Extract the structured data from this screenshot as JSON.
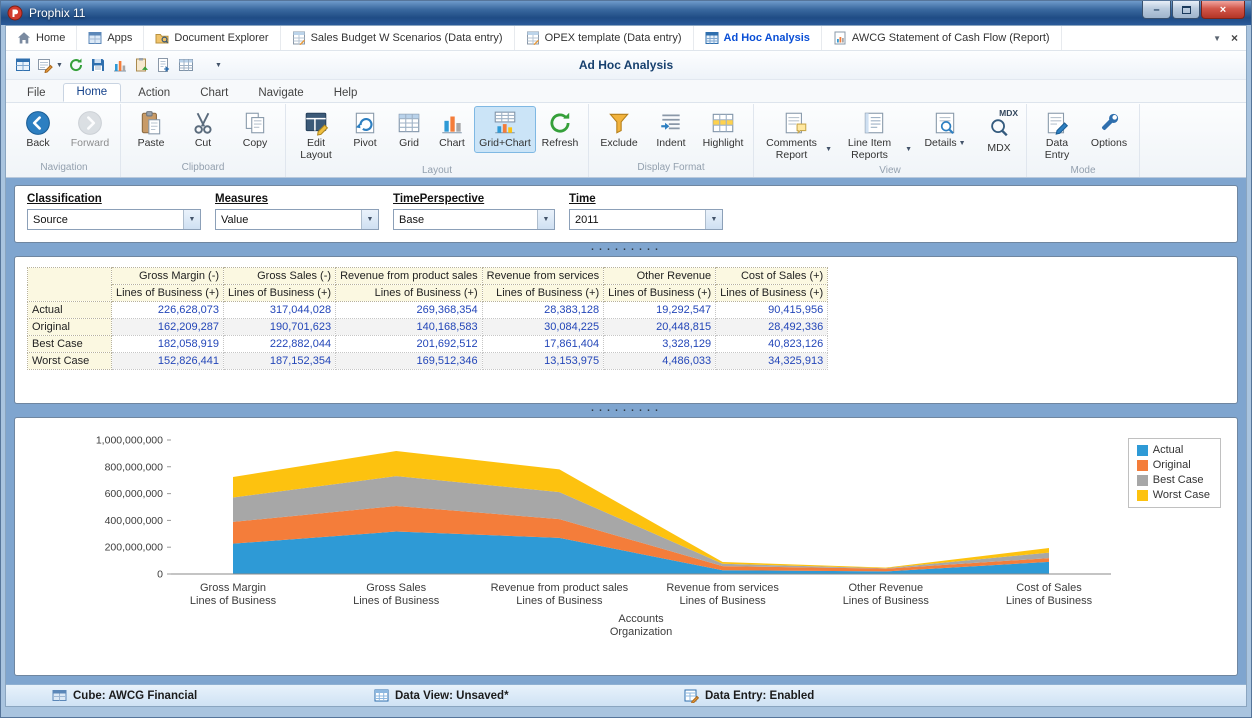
{
  "window": {
    "title": "Prophix 11",
    "controls": {
      "minimize": "–",
      "close": "×"
    }
  },
  "icons": {
    "dropdown": "▼",
    "tab_close": "×"
  },
  "splitter_dots": "·········",
  "tabs": [
    {
      "label": "Home"
    },
    {
      "label": "Apps"
    },
    {
      "label": "Document Explorer"
    },
    {
      "label": "Sales Budget W Scenarios (Data entry)"
    },
    {
      "label": "OPEX template (Data entry)"
    },
    {
      "label": "Ad Hoc Analysis",
      "active": true
    },
    {
      "label": "AWCG Statement of Cash Flow (Report)"
    }
  ],
  "toolbar_title": "Ad Hoc Analysis",
  "menus": {
    "items": [
      "File",
      "Home",
      "Action",
      "Chart",
      "Navigate",
      "Help"
    ],
    "active": "Home"
  },
  "ribbon": {
    "buttons": {
      "back": "Back",
      "forward": "Forward",
      "paste": "Paste",
      "cut": "Cut",
      "copy": "Copy",
      "edit_layout": "Edit Layout",
      "pivot": "Pivot",
      "grid": "Grid",
      "chart": "Chart",
      "grid_chart": "Grid+Chart",
      "refresh": "Refresh",
      "exclude": "Exclude",
      "indent": "Indent",
      "highlight": "Highlight",
      "comments_report": "Comments Report",
      "line_item_reports": "Line Item Reports",
      "details": "Details",
      "mdx": "MDX",
      "data_entry": "Data Entry",
      "options": "Options"
    },
    "mdx_overlay": "MDX",
    "active_button": "Grid+Chart",
    "groups": {
      "navigation": "Navigation",
      "clipboard": "Clipboard",
      "layout": "Layout",
      "display_format": "Display Format",
      "view": "View",
      "mode": "Mode"
    }
  },
  "filters": [
    {
      "label": "Classification",
      "value": "Source"
    },
    {
      "label": "Measures",
      "value": "Value"
    },
    {
      "label": "TimePerspective",
      "value": "Base"
    },
    {
      "label": "Time",
      "value": "2011"
    }
  ],
  "grid": {
    "value_color": "#2346b8",
    "columns": [
      "Gross Margin (-)",
      "Gross Sales (-)",
      "Revenue from product sales",
      "Revenue from services",
      "Other Revenue",
      "Cost of Sales (+)"
    ],
    "subheader": "Lines of Business (+)",
    "rows": [
      {
        "label": "Actual",
        "values": [
          "226,628,073",
          "317,044,028",
          "269,368,354",
          "28,383,128",
          "19,292,547",
          "90,415,956"
        ]
      },
      {
        "label": "Original",
        "values": [
          "162,209,287",
          "190,701,623",
          "140,168,583",
          "30,084,225",
          "20,448,815",
          "28,492,336"
        ]
      },
      {
        "label": "Best Case",
        "values": [
          "182,058,919",
          "222,882,044",
          "201,692,512",
          "17,861,404",
          "3,328,129",
          "40,823,126"
        ]
      },
      {
        "label": "Worst Case",
        "values": [
          "152,826,441",
          "187,152,354",
          "169,512,346",
          "13,153,975",
          "4,486,033",
          "34,325,913"
        ]
      }
    ]
  },
  "chart_data": {
    "type": "area",
    "stacked": true,
    "categories": [
      [
        "Gross Margin",
        "Lines of Business"
      ],
      [
        "Gross Sales",
        "Lines of Business"
      ],
      [
        "Revenue from product sales",
        "Lines of Business"
      ],
      [
        "Revenue from services",
        "Lines of Business"
      ],
      [
        "Other Revenue",
        "Lines of Business"
      ],
      [
        "Cost of Sales",
        "Lines of Business"
      ]
    ],
    "series": [
      {
        "name": "Actual",
        "color": "#2e9ad6",
        "values": [
          226628073,
          317044028,
          269368354,
          28383128,
          19292547,
          90415956
        ]
      },
      {
        "name": "Original",
        "color": "#f47d3a",
        "values": [
          162209287,
          190701623,
          140168583,
          30084225,
          20448815,
          28492336
        ]
      },
      {
        "name": "Best Case",
        "color": "#a7a7a7",
        "values": [
          182058919,
          222882044,
          201692512,
          17861404,
          3328129,
          40823126
        ]
      },
      {
        "name": "Worst Case",
        "color": "#fdc20f",
        "values": [
          152826441,
          187152354,
          169512346,
          13153975,
          4486033,
          34325913
        ]
      }
    ],
    "ylim": [
      0,
      1000000000
    ],
    "ytick_step": 200000000,
    "xlabel": [
      "Accounts",
      "Organization"
    ],
    "legend_position": "right",
    "grid": false
  },
  "statusbar": [
    {
      "label": "Cube: AWCG Financial"
    },
    {
      "label": "Data View: Unsaved*"
    },
    {
      "label": "Data Entry: Enabled"
    }
  ]
}
